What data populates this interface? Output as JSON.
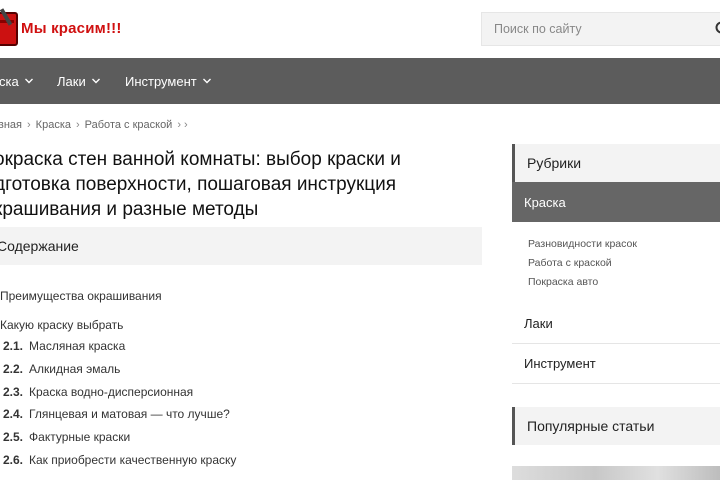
{
  "header": {
    "logo_text": "Мы красим!!!",
    "search_placeholder": "Поиск по сайту"
  },
  "nav": {
    "items": [
      {
        "label": "ска"
      },
      {
        "label": "Лаки"
      },
      {
        "label": "Инструмент"
      }
    ]
  },
  "breadcrumb": {
    "items": [
      "вная",
      "Краска",
      "Работа с краской"
    ],
    "trailing": "› ›"
  },
  "article": {
    "title_line1": "окраска стен ванной комнаты: выбор краски и",
    "title_line2": "дготовка поверхности, пошаговая инструкция",
    "title_line3": "крашивания и разные методы"
  },
  "toc": {
    "heading": "Содержание",
    "items": [
      {
        "label": "Преимущества окрашивания"
      },
      {
        "label": "Какую краску выбрать"
      }
    ],
    "subitems": [
      {
        "num": "2.1.",
        "label": "Масляная краска"
      },
      {
        "num": "2.2.",
        "label": "Алкидная эмаль"
      },
      {
        "num": "2.3.",
        "label": "Краска водно-дисперсионная"
      },
      {
        "num": "2.4.",
        "label": "Глянцевая и матовая — что лучше?"
      },
      {
        "num": "2.5.",
        "label": "Фактурные краски"
      },
      {
        "num": "2.6.",
        "label": "Как приобрести качественную краску"
      }
    ]
  },
  "sidebar": {
    "rubriki": "Рубрики",
    "active": "Краска",
    "subitems": [
      "Разновидности красок",
      "Работа с краской",
      "Покраска авто"
    ],
    "items": [
      "Лаки",
      "Инструмент"
    ],
    "popular": "Популярные статьи"
  },
  "colors": {
    "accent": "#d01010",
    "nav_bg": "#5c5c5c",
    "active_bg": "#666666"
  }
}
